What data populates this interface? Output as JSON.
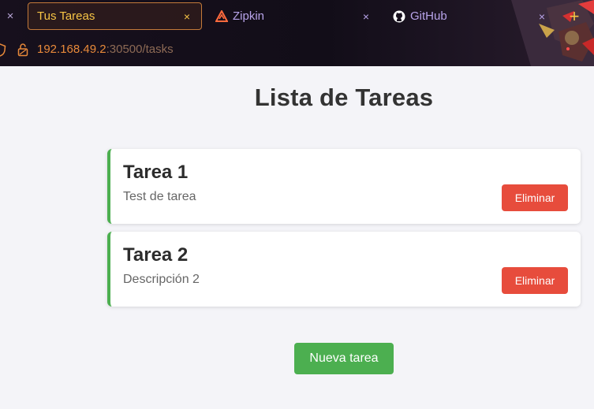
{
  "browser": {
    "tabs": [
      {
        "label": "Tus Tareas",
        "active": true,
        "icon": "none"
      },
      {
        "label": "Zipkin",
        "active": false,
        "icon": "zipkin-icon"
      },
      {
        "label": "GitHub",
        "active": false,
        "icon": "github-icon"
      }
    ],
    "close_glyph": "×",
    "new_tab_glyph": "+",
    "url": {
      "host": "192.168.49.2",
      "rest": ":30500/tasks"
    },
    "colors": {
      "active_tab_text": "#f6c445",
      "inactive_tab_text": "#b8a4ea",
      "url_host": "#e98a3a"
    }
  },
  "page": {
    "title": "Lista de Tareas",
    "tasks": [
      {
        "title": "Tarea 1",
        "description": "Test de tarea",
        "delete_label": "Eliminar"
      },
      {
        "title": "Tarea 2",
        "description": "Descripción 2",
        "delete_label": "Eliminar"
      }
    ],
    "new_task_label": "Nueva tarea",
    "colors": {
      "accent": "#4caf50",
      "danger": "#e74c3c",
      "background": "#f4f4f8"
    }
  }
}
